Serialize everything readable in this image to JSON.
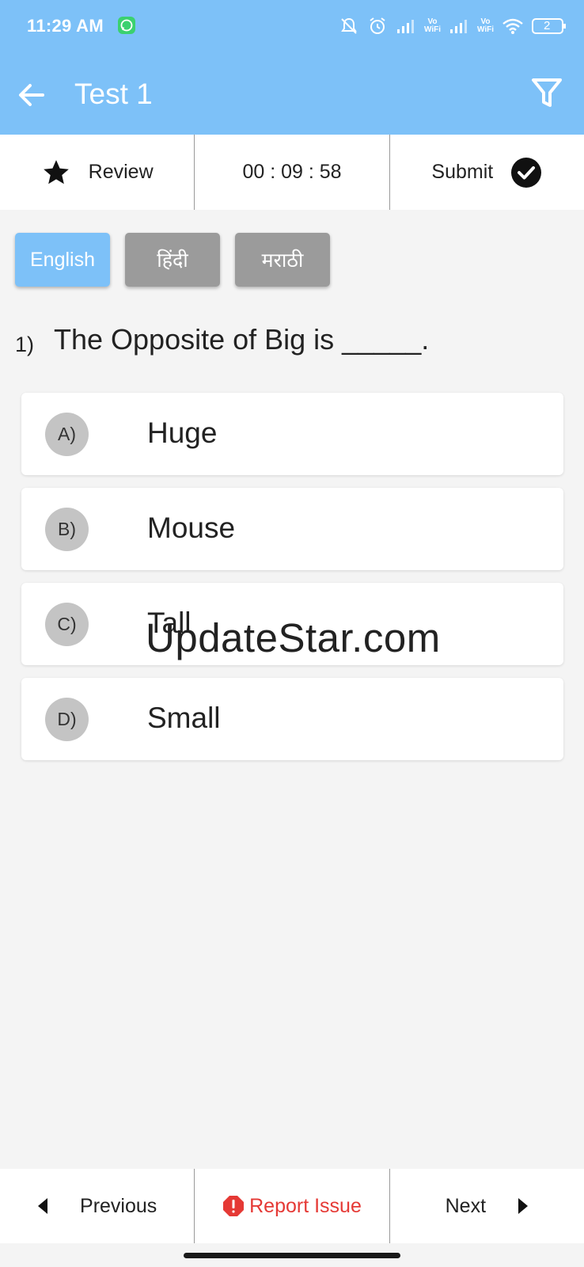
{
  "status_bar": {
    "time": "11:29 AM",
    "icons": [
      "whatsapp-icon",
      "mute-icon",
      "alarm-icon",
      "signal-icon",
      "vowifi-icon",
      "signal-icon",
      "vowifi-icon",
      "wifi-icon",
      "battery-icon"
    ],
    "vowifi_label_top": "Vo",
    "vowifi_label_bottom": "WiFi",
    "battery_level": "2"
  },
  "app_bar": {
    "title": "Test 1",
    "icons": [
      "back-arrow-icon",
      "filter-icon"
    ],
    "color": "#7dc1f8"
  },
  "top_bar": {
    "review_label": "Review",
    "timer": "00 : 09 : 58",
    "submit_label": "Submit"
  },
  "languages": [
    {
      "label": "English",
      "active": true
    },
    {
      "label": "हिंदी",
      "active": false
    },
    {
      "label": "मराठी",
      "active": false
    }
  ],
  "question": {
    "number": "1)",
    "text": "The Opposite of Big is _____."
  },
  "options": [
    {
      "letter": "A)",
      "text": "Huge"
    },
    {
      "letter": "B)",
      "text": "Mouse"
    },
    {
      "letter": "C)",
      "text": "Tall"
    },
    {
      "letter": "D)",
      "text": "Small"
    }
  ],
  "watermark": "UpdateStar.com",
  "bottom_bar": {
    "previous_label": "Previous",
    "report_label": "Report Issue",
    "next_label": "Next",
    "report_color": "#e53935"
  }
}
